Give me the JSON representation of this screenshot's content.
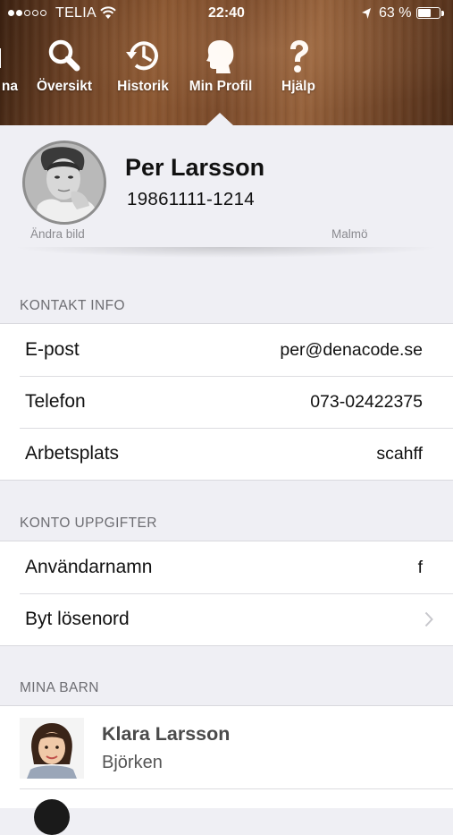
{
  "status_bar": {
    "carrier": "TELIA",
    "time": "22:40",
    "battery_percent": "63 %",
    "battery_level": 0.63,
    "signal_bars_filled": 2,
    "signal_bars_total": 5
  },
  "tabs": [
    {
      "label": "na",
      "icon": "partial-tab-icon"
    },
    {
      "label": "Översikt",
      "icon": "search-icon"
    },
    {
      "label": "Historik",
      "icon": "history-icon"
    },
    {
      "label": "Min Profil",
      "icon": "profile-head-icon",
      "selected": true
    },
    {
      "label": "Hjälp",
      "icon": "question-icon"
    }
  ],
  "profile": {
    "name": "Per Larsson",
    "personal_number": "19861111-1214",
    "edit_photo_label": "Ändra bild",
    "city": "Malmö"
  },
  "contact": {
    "header": "KONTAKT INFO",
    "rows": [
      {
        "label": "E-post",
        "value": "per@denacode.se"
      },
      {
        "label": "Telefon",
        "value": "073-02422375"
      },
      {
        "label": "Arbetsplats",
        "value": "scahff"
      }
    ]
  },
  "account": {
    "header": "KONTO UPPGIFTER",
    "username_label": "Användarnamn",
    "username_value": "f",
    "change_password_label": "Byt lösenord"
  },
  "children": {
    "header": "MINA BARN",
    "items": [
      {
        "name": "Klara Larsson",
        "group": "Björken"
      }
    ]
  },
  "colors": {
    "background": "#efeff4",
    "section_text": "#6d6d72",
    "secondary_text": "#8a8a8f",
    "header_wood": "#7a4a2a"
  }
}
